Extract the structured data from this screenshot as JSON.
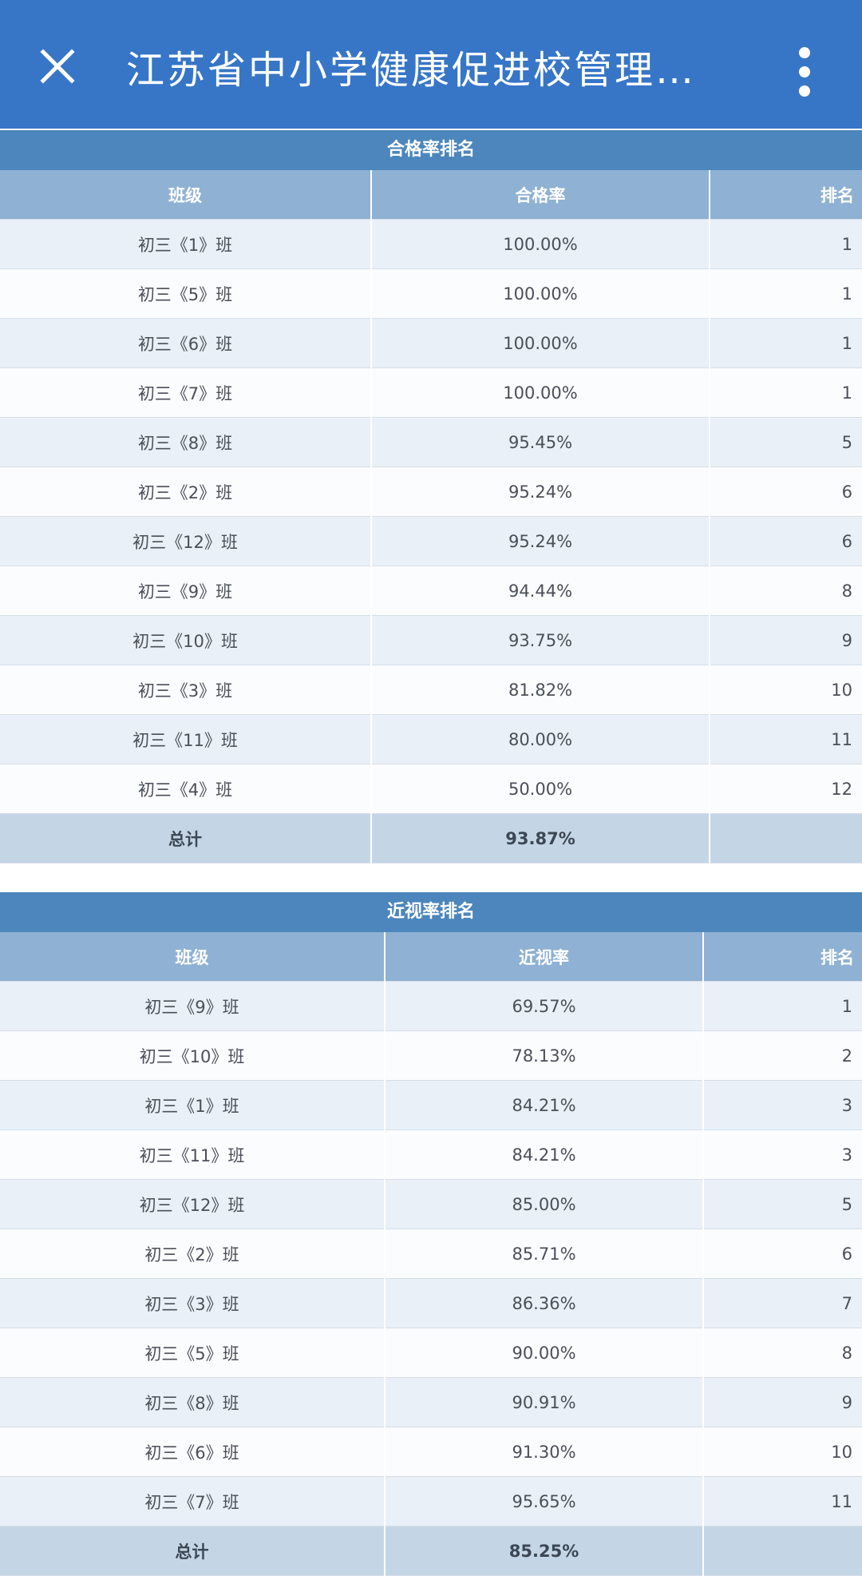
{
  "app_bar": {
    "title": "江苏省中小学健康促进校管理…",
    "close_icon": "close-icon",
    "more_icon": "more-vertical-icon",
    "bg_color": "#3776c7"
  },
  "pass_rate_table": {
    "title": "合格率排名",
    "headers": [
      "班级",
      "合格率",
      "排名"
    ],
    "rows": [
      {
        "class": "初三《1》班",
        "value": "100.00%",
        "rank": "1"
      },
      {
        "class": "初三《5》班",
        "value": "100.00%",
        "rank": "1"
      },
      {
        "class": "初三《6》班",
        "value": "100.00%",
        "rank": "1"
      },
      {
        "class": "初三《7》班",
        "value": "100.00%",
        "rank": "1"
      },
      {
        "class": "初三《8》班",
        "value": "95.45%",
        "rank": "5"
      },
      {
        "class": "初三《2》班",
        "value": "95.24%",
        "rank": "6"
      },
      {
        "class": "初三《12》班",
        "value": "95.24%",
        "rank": "6"
      },
      {
        "class": "初三《9》班",
        "value": "94.44%",
        "rank": "8"
      },
      {
        "class": "初三《10》班",
        "value": "93.75%",
        "rank": "9"
      },
      {
        "class": "初三《3》班",
        "value": "81.82%",
        "rank": "10"
      },
      {
        "class": "初三《11》班",
        "value": "80.00%",
        "rank": "11"
      },
      {
        "class": "初三《4》班",
        "value": "50.00%",
        "rank": "12"
      }
    ],
    "total": {
      "label": "总计",
      "value": "93.87%",
      "rank": ""
    }
  },
  "myopia_rate_table": {
    "title": "近视率排名",
    "headers": [
      "班级",
      "近视率",
      "排名"
    ],
    "rows": [
      {
        "class": "初三《9》班",
        "value": "69.57%",
        "rank": "1"
      },
      {
        "class": "初三《10》班",
        "value": "78.13%",
        "rank": "2"
      },
      {
        "class": "初三《1》班",
        "value": "84.21%",
        "rank": "3"
      },
      {
        "class": "初三《11》班",
        "value": "84.21%",
        "rank": "3"
      },
      {
        "class": "初三《12》班",
        "value": "85.00%",
        "rank": "5"
      },
      {
        "class": "初三《2》班",
        "value": "85.71%",
        "rank": "6"
      },
      {
        "class": "初三《3》班",
        "value": "86.36%",
        "rank": "7"
      },
      {
        "class": "初三《5》班",
        "value": "90.00%",
        "rank": "8"
      },
      {
        "class": "初三《8》班",
        "value": "90.91%",
        "rank": "9"
      },
      {
        "class": "初三《6》班",
        "value": "91.30%",
        "rank": "10"
      },
      {
        "class": "初三《7》班",
        "value": "95.65%",
        "rank": "11"
      }
    ],
    "total": {
      "label": "总计",
      "value": "85.25%",
      "rank": ""
    }
  }
}
